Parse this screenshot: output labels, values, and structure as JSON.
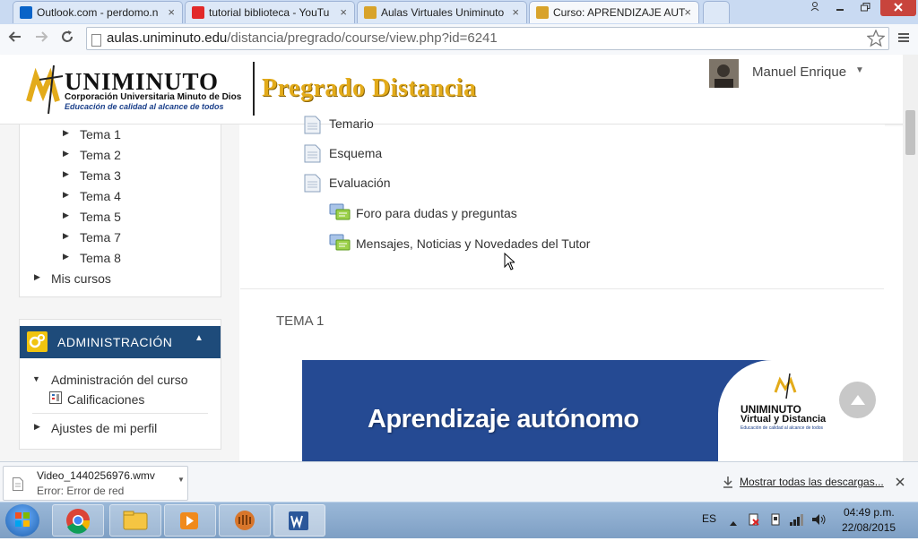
{
  "browser": {
    "tabs": [
      {
        "title": "Outlook.com - perdomo.n",
        "icon_color": "#0a64c8",
        "active": false
      },
      {
        "title": "tutorial biblioteca - YouTu",
        "icon_color": "#e22929",
        "active": false
      },
      {
        "title": "Aulas Virtuales Uniminuto",
        "icon_color": "#d8a32a",
        "active": false
      },
      {
        "title": "Curso: APRENDIZAJE AUT",
        "icon_color": "#d8a32a",
        "active": true
      }
    ],
    "close_glyph": "×",
    "url_host": "aulas.uniminuto.edu",
    "url_path": "/distancia/pregrado/course/view.php?id=6241"
  },
  "header": {
    "logo_name": "UNIMINUTO",
    "logo_line1": "Corporación Universitaria Minuto de Dios",
    "logo_line2": "Educación de calidad al alcance de todos",
    "site_title": "Pregrado Distancia",
    "user_name": "Manuel Enrique"
  },
  "sidebar": {
    "temas": [
      "Tema 1",
      "Tema 2",
      "Tema 3",
      "Tema 4",
      "Tema 5",
      "Tema 7",
      "Tema 8"
    ],
    "mis_cursos": "Mis cursos",
    "admin_title": "ADMINISTRACIÓN",
    "admin_course": "Administración del curso",
    "grades": "Calificaciones",
    "profile_settings": "Ajustes de mi perfil"
  },
  "main": {
    "resources": [
      "Temario",
      "Esquema",
      "Evaluación"
    ],
    "forums": [
      "Foro para dudas y preguntas",
      "Mensajes, Noticias y Novedades del Tutor"
    ],
    "section_title": "TEMA 1",
    "banner_title": "Aprendizaje autónomo",
    "banner_logo_line1": "UNIMINUTO",
    "banner_logo_line2": "Virtual y Distancia",
    "banner_logo_line3": "Educación de calidad al alcance de todos"
  },
  "downloads": {
    "file_name": "Video_1440256976.wmv",
    "status": "Error: Error de red",
    "show_all": "Mostrar todas las descargas..."
  },
  "taskbar": {
    "language": "ES",
    "time": "04:49 p.m.",
    "date": "22/08/2015"
  },
  "colors": {
    "admin_header": "#1e4b7a",
    "banner_blue": "#254a93",
    "site_title_gold": "#e3ab1a"
  }
}
